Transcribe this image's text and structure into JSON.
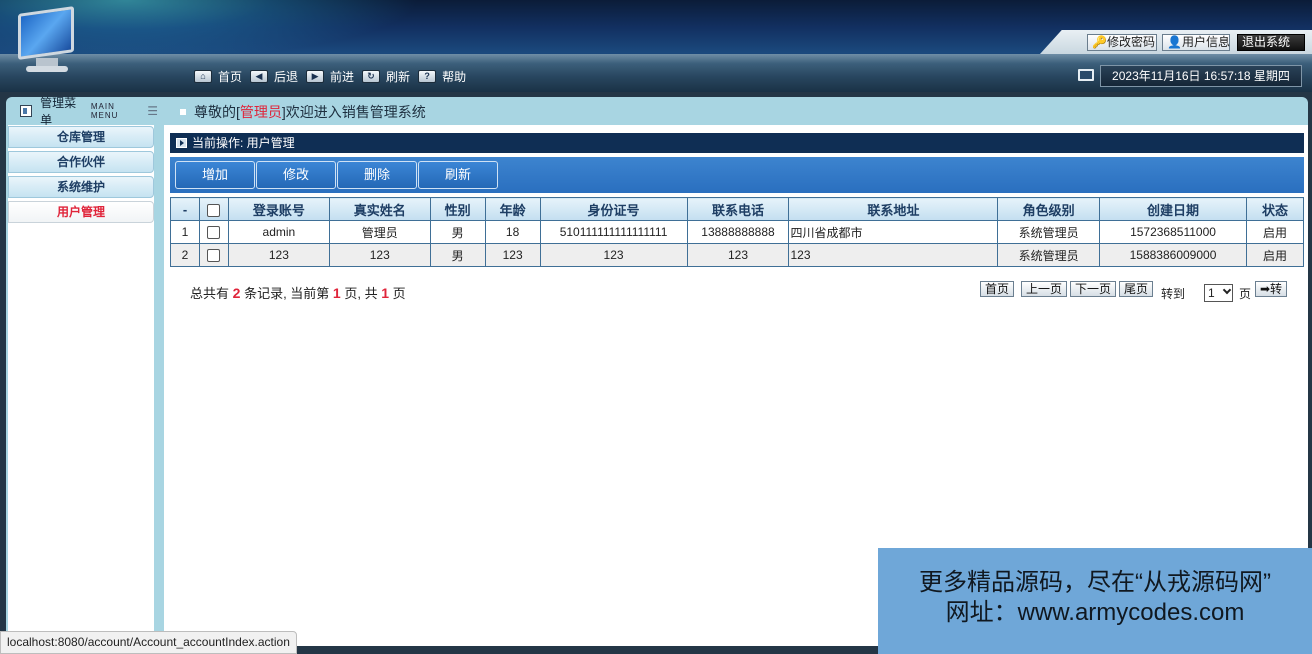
{
  "header": {
    "top_buttons": {
      "change_password": "修改密码",
      "user_info": "用户信息",
      "logout": "退出系统"
    },
    "nav": [
      {
        "icon": "home-icon",
        "label": "首页"
      },
      {
        "icon": "back-arrow-icon",
        "label": "后退"
      },
      {
        "icon": "forward-arrow-icon",
        "label": "前进"
      },
      {
        "icon": "refresh-icon",
        "label": "刷新"
      },
      {
        "icon": "help-icon",
        "label": "帮助"
      }
    ],
    "datetime": "2023年11月16日 16:57:18 星期四"
  },
  "sidebar": {
    "title": "管理菜单",
    "title_en": "MAIN MENU",
    "items": [
      {
        "label": "仓库管理",
        "active": false
      },
      {
        "label": "合作伙伴",
        "active": false
      },
      {
        "label": "系统维护",
        "active": false
      },
      {
        "label": "用户管理",
        "active": true
      }
    ]
  },
  "welcome": {
    "prefix": "尊敬的[",
    "role": "管理员",
    "suffix": "]欢迎进入销售管理系统"
  },
  "operation": {
    "label": "当前操作: 用户管理"
  },
  "actions": {
    "add": "增加",
    "edit": "修改",
    "delete": "删除",
    "refresh": "刷新"
  },
  "table": {
    "headers": [
      "-",
      "",
      "登录账号",
      "真实姓名",
      "性别",
      "年龄",
      "身份证号",
      "联系电话",
      "联系地址",
      "角色级别",
      "创建日期",
      "状态"
    ],
    "rows": [
      {
        "idx": "1",
        "account": "admin",
        "name": "管理员",
        "gender": "男",
        "age": "18",
        "id_card": "510111111111111111",
        "phone": "13888888888",
        "address": "四川省成都市",
        "role": "系统管理员",
        "created": "1572368511000",
        "status": "启用"
      },
      {
        "idx": "2",
        "account": "123",
        "name": "123",
        "gender": "男",
        "age": "123",
        "id_card": "123",
        "phone": "123",
        "address": "123",
        "role": "系统管理员",
        "created": "1588386009000",
        "status": "启用"
      }
    ]
  },
  "pager": {
    "t1": "总共有",
    "total": "2",
    "t2": "条记录, 当前第",
    "current": "1",
    "t3": "页, 共",
    "pages": "1",
    "t4": "页",
    "first": "首页",
    "prev": "上一页",
    "next": "下一页",
    "last": "尾页",
    "goto_label": "转到",
    "page_select": "1",
    "page_unit": "页",
    "go": "➡转"
  },
  "status_url": "localhost:8080/account/Account_accountIndex.action",
  "promo": {
    "line1": "更多精品源码，尽在“从戎源码网”",
    "line2": "网址：www.armycodes.com"
  },
  "colors": {
    "accent_red": "#e0243a",
    "nav_dark": "#0f2e54",
    "action_blue": "#2a6fbf"
  }
}
